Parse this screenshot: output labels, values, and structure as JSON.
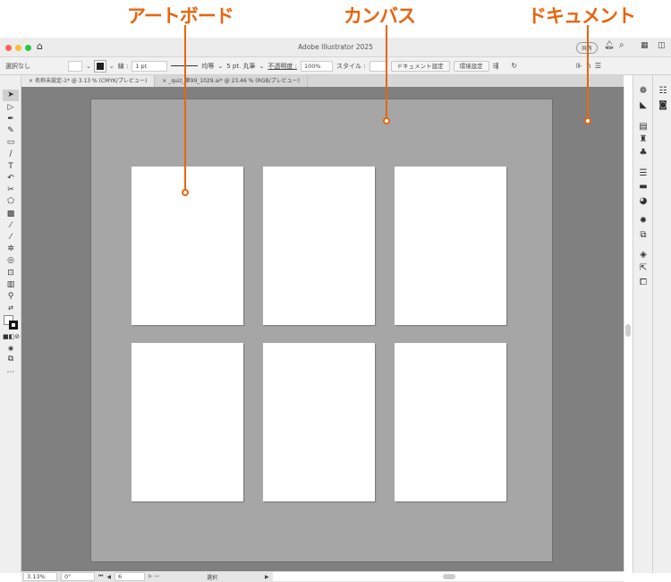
{
  "annotations": {
    "artboard": "アートボード",
    "canvas": "カンバス",
    "document": "ドキュメント",
    "color": "#e8650f"
  },
  "app": {
    "title": "Adobe Illustrator 2025",
    "share": "共有"
  },
  "control": {
    "selection": "選択なし",
    "stroke_label": "線 :",
    "stroke_value": "1 pt",
    "profile": "均等",
    "brush": "5 pt. 丸筆",
    "opacity_label": "不透明度 :",
    "opacity_value": "100%",
    "style_label": "スタイル :",
    "doc_settings": "ドキュメント設定",
    "preferences": "環境設定"
  },
  "tabs": [
    {
      "label": "名称未設定-1* @ 3.13 % (CMYK/プレビュー)"
    },
    {
      "label": "_quiz_第99_1029.ai* @ 23.46 % (RGB/プレビュー)"
    }
  ],
  "status": {
    "zoom": "3.13%",
    "rotate": "0°",
    "artboard_num": "6",
    "tool": "選択"
  },
  "colors": {
    "canvas": "#a6a6a6",
    "pasteboard": "#808080",
    "artboard": "#ffffff"
  }
}
